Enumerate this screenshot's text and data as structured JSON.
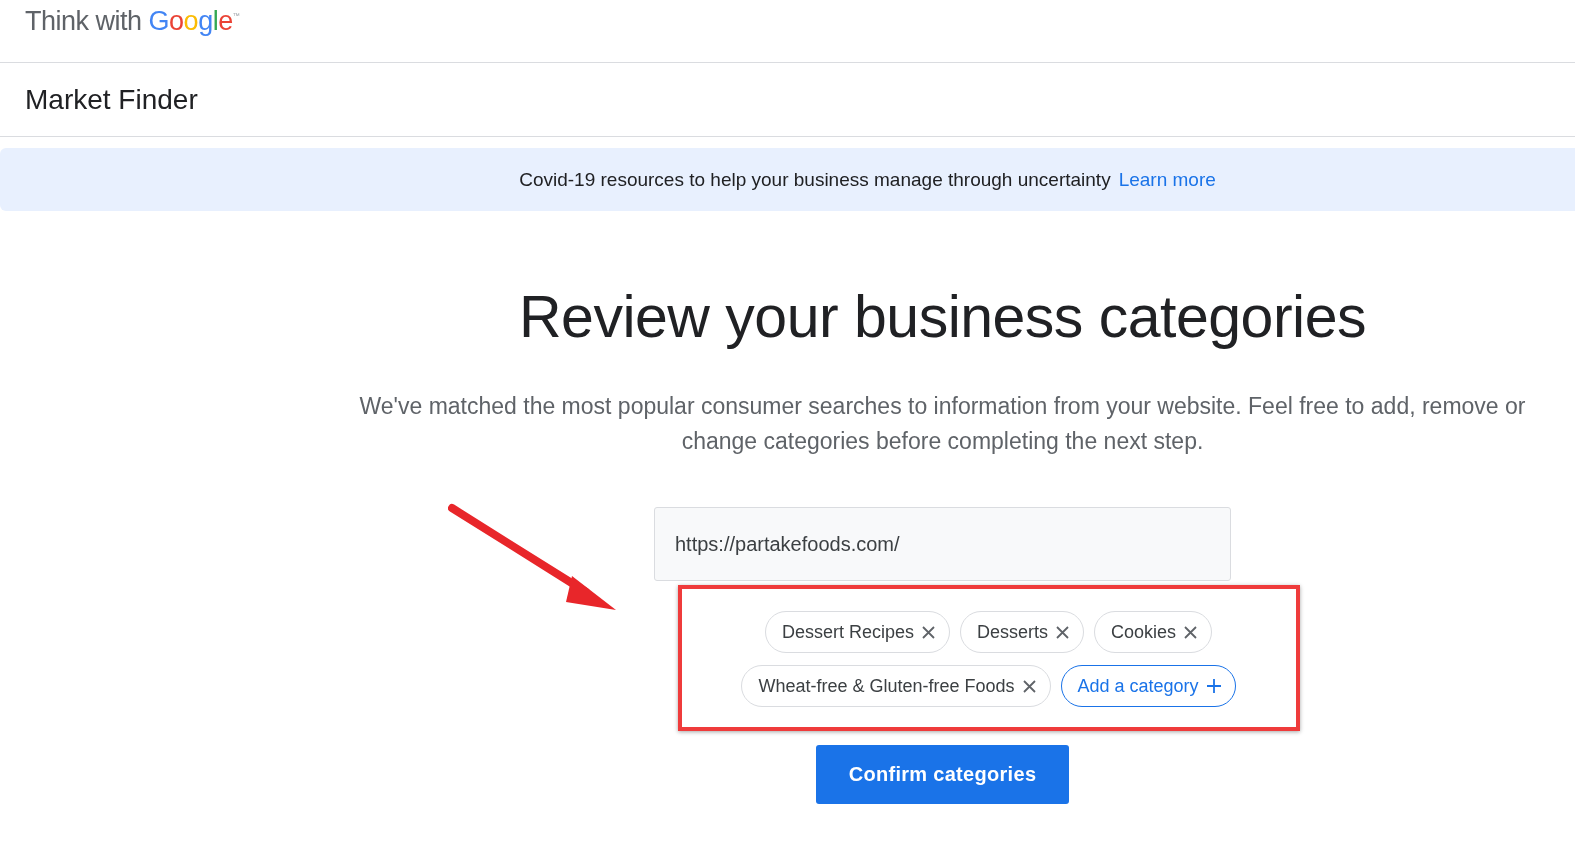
{
  "header": {
    "logo_prefix": "Think with ",
    "logo_brand": "Google",
    "trademark": "™"
  },
  "product_title": "Market Finder",
  "banner": {
    "text": "Covid-19 resources to help your business manage through uncertainty",
    "link": "Learn more"
  },
  "heading": "Review your business categories",
  "description": "We've matched the most popular consumer searches to information from your website. Feel free to add, remove or change categories before completing the next step.",
  "url_field": {
    "value": "https://partakefoods.com/"
  },
  "categories": [
    {
      "label": "Dessert Recipes",
      "kind": "chip"
    },
    {
      "label": "Desserts",
      "kind": "chip"
    },
    {
      "label": "Cookies",
      "kind": "chip"
    },
    {
      "label": "Wheat-free & Gluten-free Foods",
      "kind": "chip"
    },
    {
      "label": "Add a category",
      "kind": "add"
    }
  ],
  "confirm_button": "Confirm categories"
}
